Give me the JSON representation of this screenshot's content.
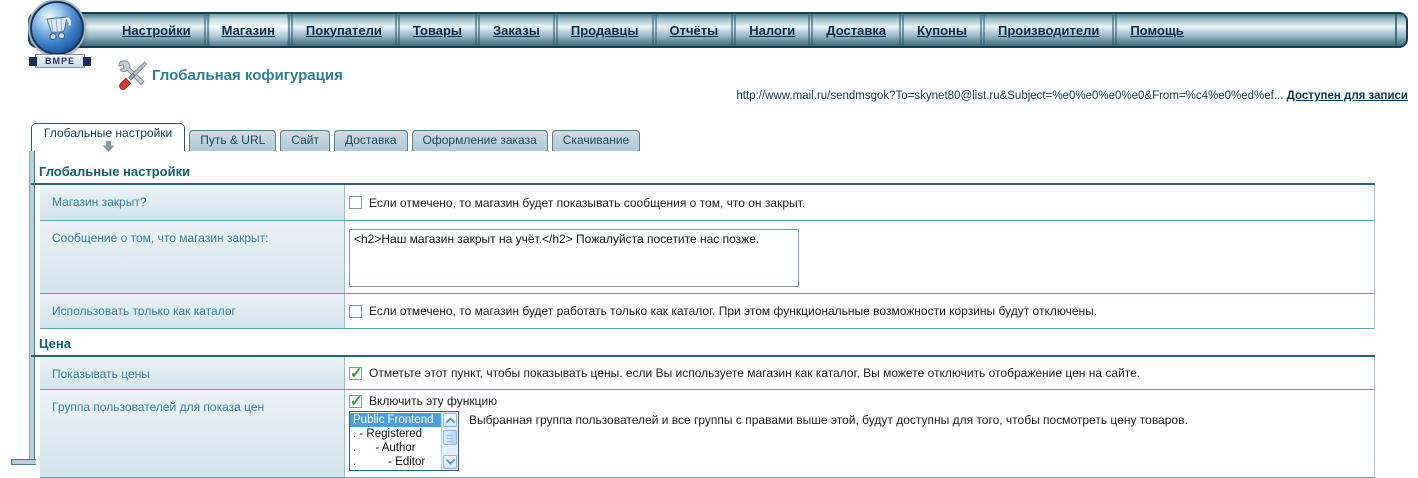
{
  "brand": {
    "name": "BMPE"
  },
  "nav": {
    "items": [
      "Настройки",
      "Магазин",
      "Покупатели",
      "Товары",
      "Заказы",
      "Продавцы",
      "Отчёты",
      "Налоги",
      "Доставка",
      "Купоны",
      "Производители",
      "Помощь"
    ],
    "active_item": "Магазин"
  },
  "header": {
    "title": "Глобальная кофигурация",
    "url_text": "http://www.mail.ru/sendmsgok?To=skynet80@list.ru&Subject=%e0%e0%e0%e0&From=%c4%e0%ed%ef...",
    "write_status": "Доступен для записи"
  },
  "tabs": {
    "items": [
      "Глобальные настройки",
      "Путь & URL",
      "Сайт",
      "Доставка",
      "Оформление заказа",
      "Скачивание"
    ],
    "active": "Глобальные настройки"
  },
  "icons": {
    "logo": "shopping-cart-icon",
    "title": "tools-icon",
    "active_tab_arrow": "down-arrow-icon"
  },
  "form": {
    "sections": [
      {
        "title": "Глобальные настройки"
      },
      {
        "title": "Цена"
      }
    ],
    "rows": [
      {
        "label": "Магазин закрыт?",
        "checked": false,
        "desc": "Если отмечено, то магазин будет показывать сообщения о том, что он закрыт."
      },
      {
        "label": "Сообщение о том, что магазин закрыт:",
        "textarea_value": "<h2>Наш магазин закрыт на учёт.</h2> Пожалуйста посетите нас позже."
      },
      {
        "label": "Использовать только как каталог",
        "checked": false,
        "desc": "Если отмечено, то магазин будет работать только как каталог. При этом функциональные возможности корзины будут отключены."
      },
      {
        "label": "Показывать цены",
        "checked": true,
        "desc": "Отметьте этот пункт, чтобы показывать цены. если Вы используете магазин как каталог, Вы можете отключить отображение цен на сайте."
      },
      {
        "label": "Группа пользователей для показа цен",
        "checked": true,
        "checkbox_label": "Включить эту функцию",
        "list": {
          "items": [
            "Public Frontend",
            ". - Registered",
            ".      - Author",
            ".          - Editor"
          ],
          "selected": "Public Frontend"
        },
        "desc": "Выбранная группа пользователей и все группы с правами выше этой, будут доступны для того, чтобы посмотреть цену товаров."
      }
    ]
  },
  "colors": {
    "accent_teal": "#2d7f95",
    "section_title": "#11606f",
    "selection_blue": "#4d9edc",
    "check_green": "#2f9e2f",
    "nav_text": "#0a2f42"
  }
}
